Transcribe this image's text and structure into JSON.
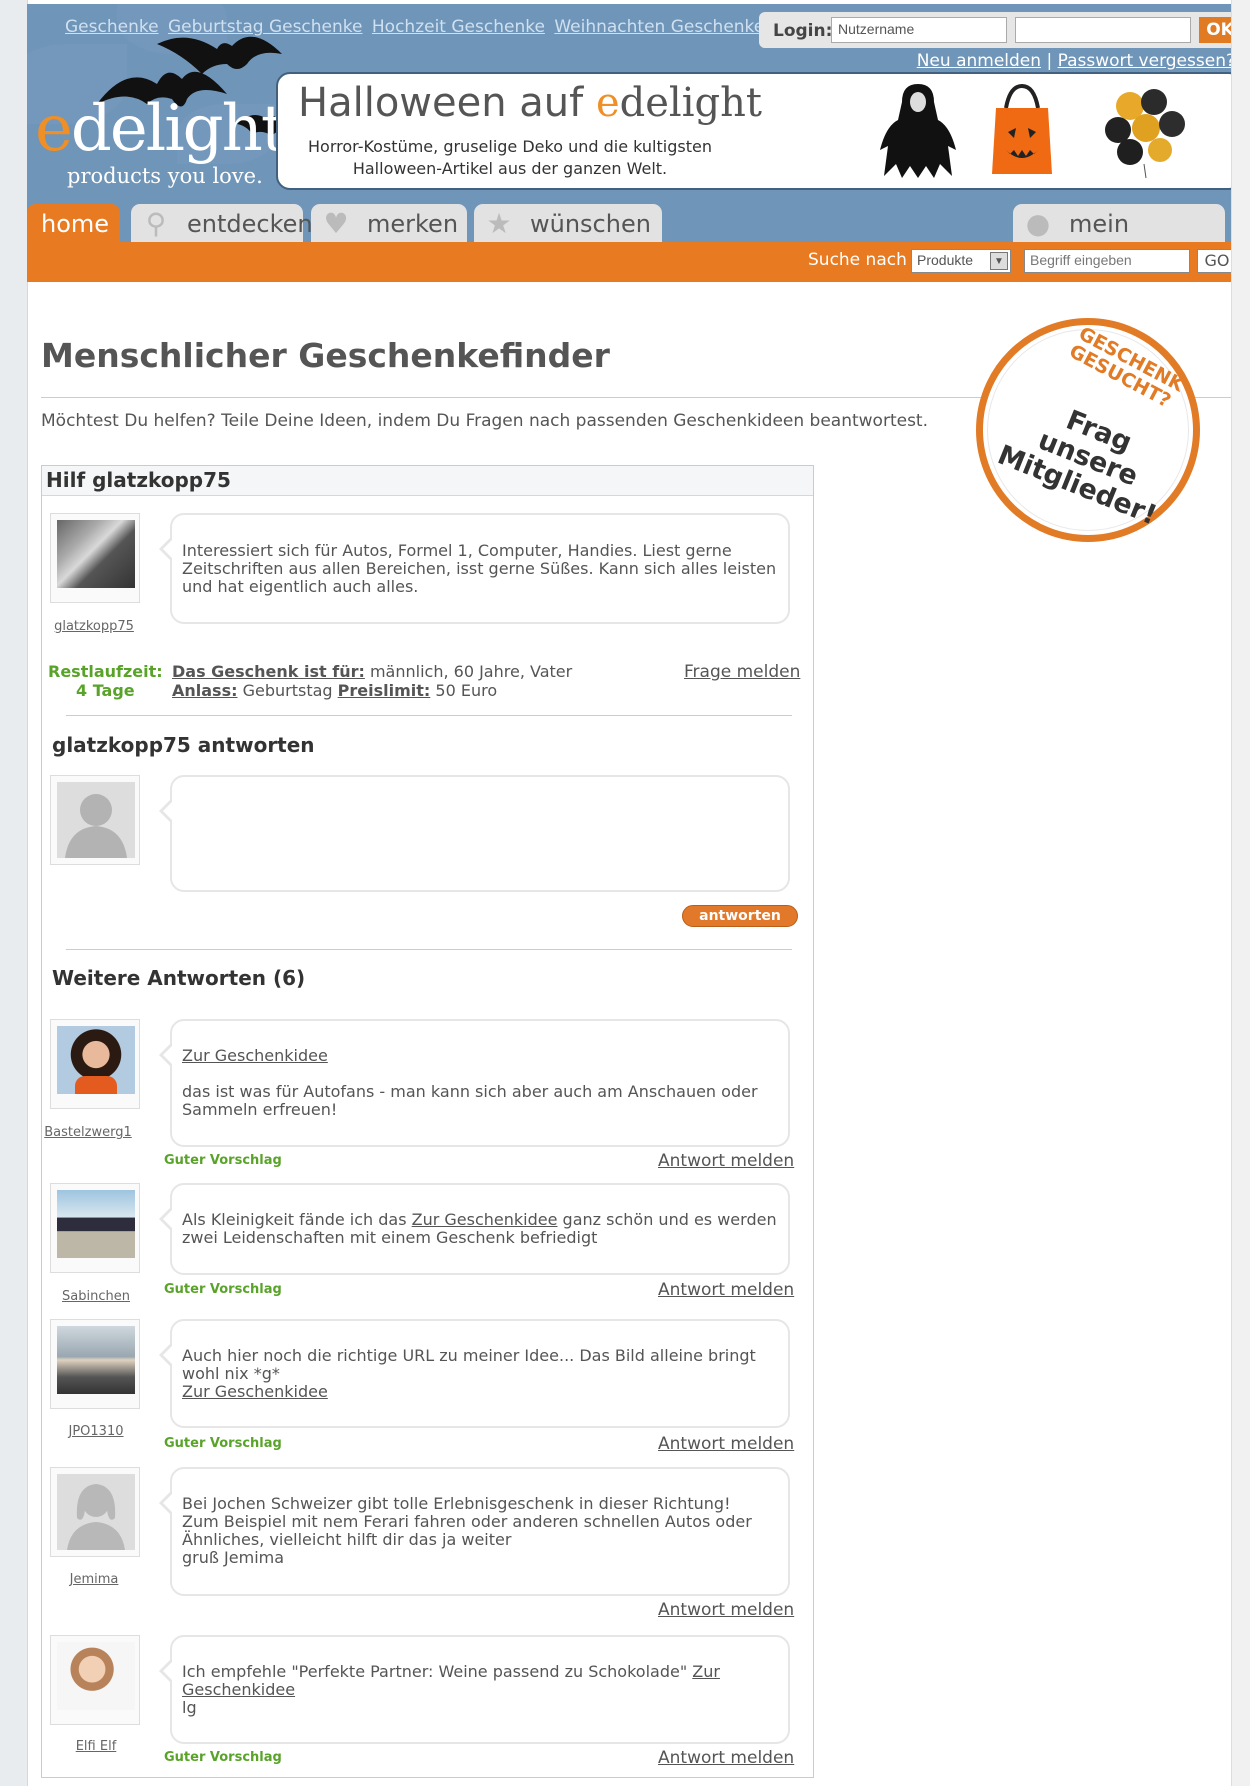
{
  "header": {
    "top_links": [
      "Geschenke",
      "Geburtstag Geschenke",
      "Hochzeit Geschenke",
      "Weihnachten Geschenke"
    ],
    "login_label": "Login:",
    "username_placeholder": "Nutzername",
    "ok_label": "OK",
    "register_link": "Neu anmelden",
    "separator": "|",
    "forgot_link": "Passwort vergessen?",
    "logo_first": "e",
    "logo_rest": "delight",
    "slogan": "products you love.",
    "banner_title_prefix": "Halloween auf ",
    "banner_brand_e": "e",
    "banner_brand_rest": "delight",
    "banner_subtitle": "Horror-Kostüme, gruselige Deko und die kultigsten Halloween-Artikel aus der ganzen Welt."
  },
  "nav": {
    "home": "home",
    "entdecken": "entdecken",
    "merken": "merken",
    "wuenschen": "wünschen",
    "mein": "mein edelight"
  },
  "search": {
    "label": "Suche nach",
    "select_value": "Produkte",
    "input_placeholder": "Begriff eingeben",
    "go_label": "GO"
  },
  "main": {
    "title": "Menschlicher Geschenkefinder",
    "intro": "Möchtest Du helfen? Teile Deine Ideen, indem Du Fragen nach passenden Geschenkideen beantwortest.",
    "stamp_top": "GESCHENK GESUCHT?",
    "stamp_main": "Frag unsere Mitglieder!"
  },
  "question": {
    "header": "Hilf glatzkopp75",
    "user": "glatzkopp75",
    "text": "Interessiert sich für Autos, Formel 1, Computer, Handies. Liest gerne Zeitschriften aus allen Bereichen, isst gerne Süßes. Kann sich alles leisten und hat eigentlich auch alles.",
    "remaining_label": "Restlaufzeit:",
    "remaining_value": "4 Tage",
    "for_label": "Das Geschenk ist für:",
    "for_value": "männlich, 60 Jahre, Vater",
    "occasion_label": "Anlass:",
    "occasion_value": "Geburtstag",
    "limit_label": "Preislimit:",
    "limit_value": "50 Euro",
    "report_link": "Frage melden"
  },
  "reply": {
    "heading": "glatzkopp75 antworten",
    "button": "antworten"
  },
  "answers": {
    "heading": "Weitere Antworten (6)",
    "good_label": "Guter Vorschlag",
    "report_label": "Antwort melden",
    "idea_link": "Zur Geschenkidee",
    "items": [
      {
        "user": "Bastelzwerg1",
        "text": "das ist was für Autofans - man kann sich aber auch am Anschauen oder Sammeln erfreuen!"
      },
      {
        "user": "Sabinchen",
        "text_pre": "Als Kleinigkeit fände ich das ",
        "text_post": " ganz schön und es werden zwei Leidenschaften mit einem Geschenk befriedigt"
      },
      {
        "user": "JPO1310",
        "text": "Auch hier noch die richtige URL zu meiner Idee... Das Bild alleine bringt wohl nix *g*"
      },
      {
        "user": "Jemima",
        "text_l1": "Bei Jochen Schweizer gibt tolle Erlebnisgeschenk in dieser Richtung!",
        "text_l2": "Zum Beispiel mit nem Ferari fahren oder anderen schnellen Autos oder Ähnliches, vielleicht hilft dir das ja weiter",
        "text_l3": "gruß Jemima"
      },
      {
        "user": "Elfi Elf",
        "text_pre": "Ich empfehle \"Perfekte Partner: Weine passend zu Schokolade\" ",
        "text_post": "lg"
      }
    ]
  },
  "colors": {
    "orange": "#e87b22",
    "blue": "#6f95b8",
    "green": "#5aa32a"
  }
}
